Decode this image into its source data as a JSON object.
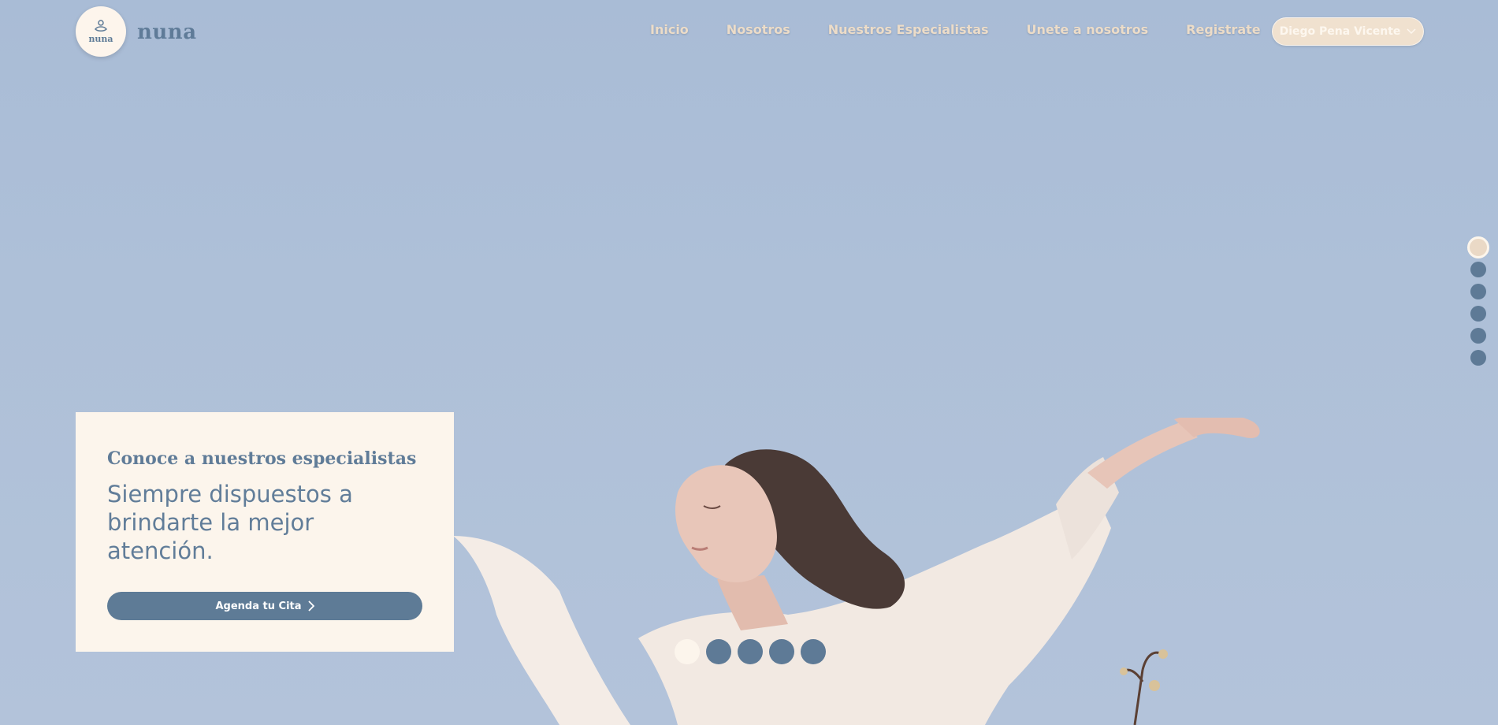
{
  "brand": {
    "logo_small": "nuna",
    "name": "nuna"
  },
  "nav": {
    "items": [
      "Inicio",
      "Nosotros",
      "Nuestros Especialistas",
      "Unete a nosotros",
      "Registrate"
    ]
  },
  "user_menu": {
    "label": "Diego Pena Vicente",
    "icon": "chevron-down-icon"
  },
  "hero": {
    "card_title": "Conoce a nuestros especialistas",
    "card_subtitle": "Siempre dispuestos a brindarte la mejor atención.",
    "cta_label": "Agenda tu Cita",
    "cta_icon": "chevron-right-icon"
  },
  "side_pagination": {
    "count": 6,
    "active_index": 0
  },
  "carousel_pagination": {
    "count": 5,
    "active_index": 0
  },
  "colors": {
    "sky": "#aebfd8",
    "accent_blue": "#5e7b96",
    "cream": "#fcf5ec",
    "nav_text": "#ecdcc8"
  }
}
